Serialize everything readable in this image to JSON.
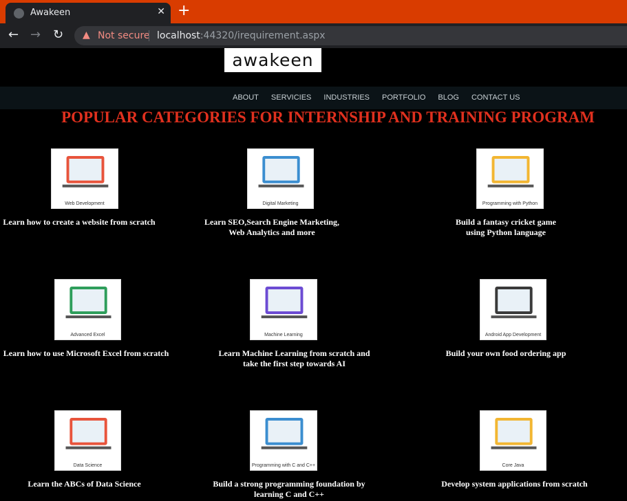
{
  "browser": {
    "tab_title": "Awakeen",
    "close_glyph": "✕",
    "new_tab_glyph": "+",
    "security_label": "Not secure",
    "url_host": "localhost",
    "url_rest": ":44320/irequirement.aspx"
  },
  "logo_text": "awakeen",
  "nav": [
    "ABOUT",
    "SERVICIES",
    "INDUSTRIES",
    "PORTFOLIO",
    "BLOG",
    "CONTACT US"
  ],
  "heading": "POPULAR CATEGORIES FOR INTERNSHIP AND TRAINING PROGRAM",
  "categories": [
    {
      "caption": "Web Development",
      "text_lines": [
        "Learn how to create a website from scratch"
      ]
    },
    {
      "caption": "Digital Marketing",
      "text_lines": [
        "Learn SEO,Search Engine Marketing,",
        "Web Analytics and more"
      ]
    },
    {
      "caption": "Programming with Python",
      "text_lines": [
        "Build a fantasy cricket game",
        "using Python language"
      ]
    },
    {
      "caption": "Advanced Excel",
      "text_lines": [
        "Learn how to use Microsoft Excel from scratch"
      ]
    },
    {
      "caption": "Machine Learning",
      "text_lines": [
        "Learn Machine Learning from scratch and",
        "take the first step towards AI"
      ]
    },
    {
      "caption": "Android App Development",
      "text_lines": [
        "Build your own food ordering app"
      ]
    },
    {
      "caption": "Data Science",
      "text_lines": [
        "Learn the ABCs of Data Science"
      ]
    },
    {
      "caption": "Programming with C and C++",
      "text_lines": [
        "Build a strong programming foundation by",
        "learning C and C++"
      ]
    },
    {
      "caption": "Core Java",
      "text_lines": [
        "Develop system applications from scratch"
      ]
    }
  ]
}
